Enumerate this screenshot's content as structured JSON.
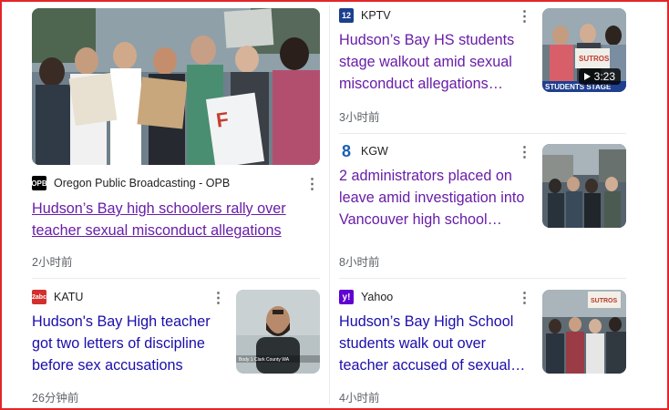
{
  "articles": [
    {
      "source": "Oregon Public Broadcasting - OPB",
      "logo_text": "OPB",
      "logo_color": "#000000",
      "headline": "Hudson’s Bay high schoolers rally over teacher sexual misconduct allegations",
      "time": "2小时前",
      "image": "students-rally-photo",
      "sign_text": "F"
    },
    {
      "source": "KPTV",
      "logo_text": "12",
      "logo_color": "#1c3f8e",
      "headline": "Hudson’s Bay HS students stage walkout amid sexual misconduct allegations…",
      "time": "3小时前",
      "image": "walkout-video-thumbnail",
      "duration": "3:23",
      "sign_text": "SUTROS",
      "banner_text": "STUDENTS STAGE"
    },
    {
      "source": "KGW",
      "logo_text": "8",
      "logo_color": "#1a5fb4",
      "headline": "2 administrators placed on leave amid investigation into Vancouver high school…",
      "time": "8小时前",
      "image": "crowd-outside-school-photo"
    },
    {
      "source": "KATU",
      "logo_text": "2abc",
      "logo_color": "#d32f2f",
      "headline": "Hudson's Bay High teacher got two letters of discipline before sex accusations",
      "time": "26分钟前",
      "image": "court-video-still",
      "caption_text": "Body 1 Clark County WA"
    },
    {
      "source": "Yahoo",
      "logo_text": "y!",
      "logo_color": "#6001d2",
      "headline": "Hudson’s Bay High School students walk out over teacher accused of sexual…",
      "time": "4小时前",
      "image": "walkout-crowd-photo",
      "sign_text": "SUTROS"
    }
  ],
  "ui": {
    "more_icon": "more-vert-icon",
    "play_icon": "play-icon"
  },
  "colors": {
    "link": "#1a0dab",
    "visited": "#681da8",
    "frame": "#e3262a"
  }
}
